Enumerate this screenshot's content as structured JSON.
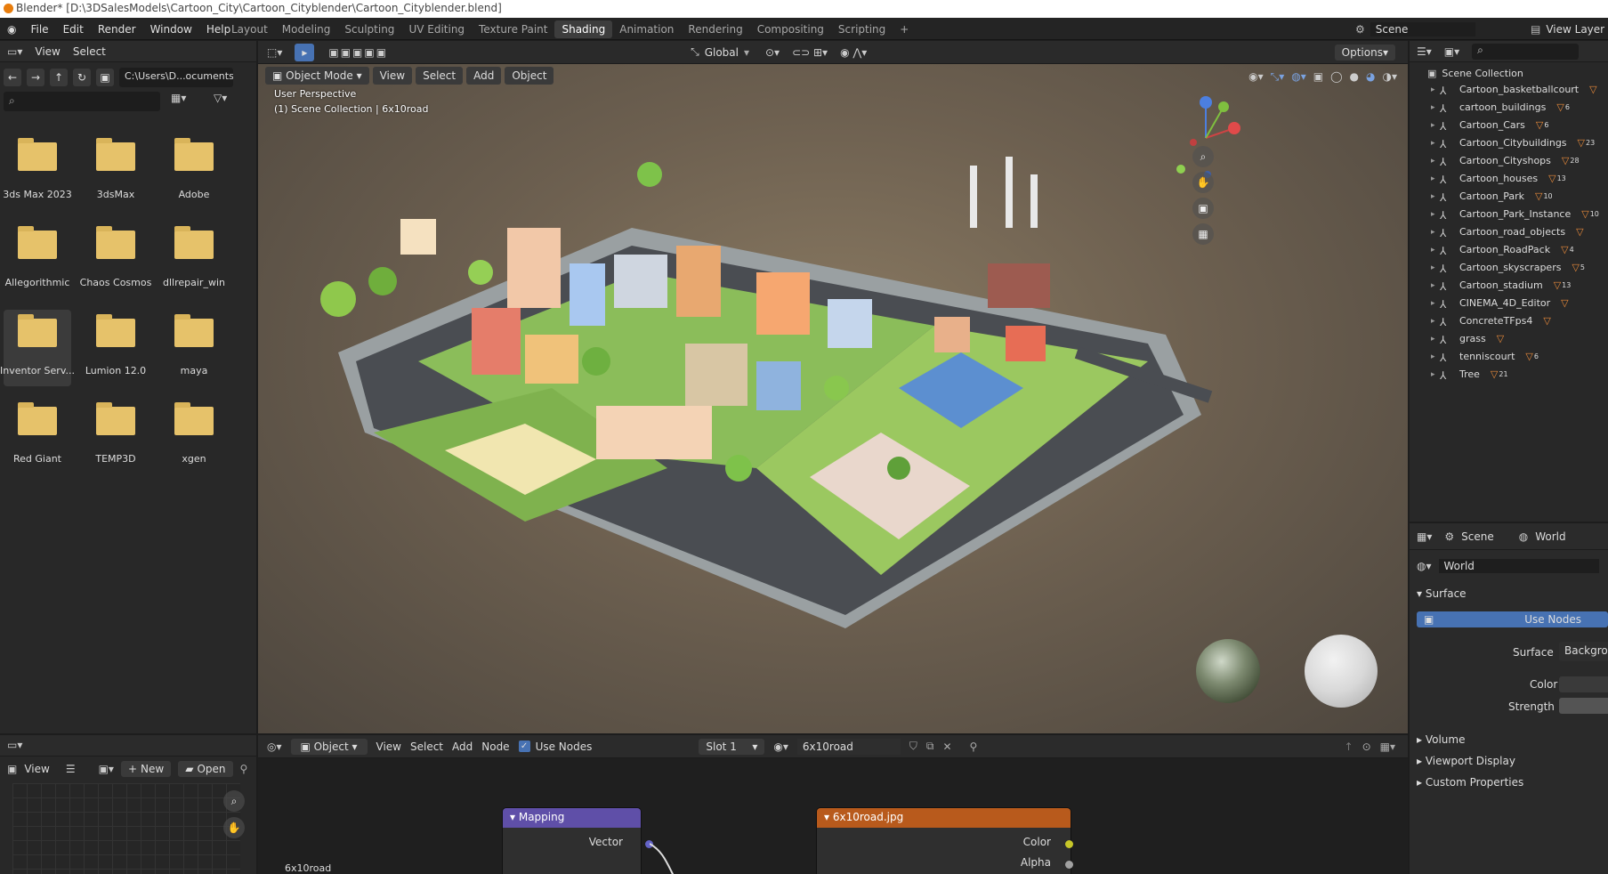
{
  "window": {
    "title": "Blender* [D:\\3DSalesModels\\Cartoon_City\\Cartoon_Cityblender\\Cartoon_Cityblender.blend]"
  },
  "menu": [
    "File",
    "Edit",
    "Render",
    "Window",
    "Help"
  ],
  "workspaces": [
    "Layout",
    "Modeling",
    "Sculpting",
    "UV Editing",
    "Texture Paint",
    "Shading",
    "Animation",
    "Rendering",
    "Compositing",
    "Scripting"
  ],
  "active_workspace": "Shading",
  "top_right": {
    "scene": "Scene",
    "view_layer": "View Layer"
  },
  "file_browser": {
    "menu_view": "View",
    "menu_select": "Select",
    "path": "C:\\Users\\D...ocuments\\",
    "search_placeholder": "",
    "folders": [
      "3ds Max 2023",
      "3dsMax",
      "Adobe",
      "Allegorithmic",
      "Chaos Cosmos",
      "dllrepair_win",
      "Inventor Serv...",
      "Lumion 12.0",
      "maya",
      "Red Giant",
      "TEMP3D",
      "xgen"
    ]
  },
  "viewport": {
    "mode": "Object Mode",
    "menus": [
      "View",
      "Select",
      "Add",
      "Object"
    ],
    "orientation": "Global",
    "options": "Options",
    "perspective": "User Perspective",
    "collection": "(1) Scene Collection | 6x10road"
  },
  "image_editor": {
    "view": "View",
    "new": "New",
    "open": "Open"
  },
  "node_editor": {
    "type": "Object",
    "menus": [
      "View",
      "Select",
      "Add",
      "Node"
    ],
    "use_nodes": "Use Nodes",
    "slot": "Slot 1",
    "material": "6x10road",
    "mapping_title": "Mapping",
    "mapping_vector": "Vector",
    "image_title": "6x10road.jpg",
    "image_color": "Color",
    "image_alpha": "Alpha",
    "frame_label": "6x10road"
  },
  "outliner": {
    "root": "Scene Collection",
    "items": [
      {
        "name": "Cartoon_basketballcourt",
        "badge": ""
      },
      {
        "name": "cartoon_buildings",
        "badge": "6"
      },
      {
        "name": "Cartoon_Cars",
        "badge": "6"
      },
      {
        "name": "Cartoon_Citybuildings",
        "badge": "23"
      },
      {
        "name": "Cartoon_Cityshops",
        "badge": "28"
      },
      {
        "name": "Cartoon_houses",
        "badge": "13"
      },
      {
        "name": "Cartoon_Park",
        "badge": "10"
      },
      {
        "name": "Cartoon_Park_Instance",
        "badge": "10"
      },
      {
        "name": "Cartoon_road_objects",
        "badge": ""
      },
      {
        "name": "Cartoon_RoadPack",
        "badge": "4"
      },
      {
        "name": "Cartoon_skyscrapers",
        "badge": "5"
      },
      {
        "name": "Cartoon_stadium",
        "badge": "13"
      },
      {
        "name": "CINEMA_4D_Editor",
        "badge": ""
      },
      {
        "name": "ConcreteTFps4",
        "badge": ""
      },
      {
        "name": "grass",
        "badge": ""
      },
      {
        "name": "tenniscourt",
        "badge": "6"
      },
      {
        "name": "Tree",
        "badge": "21"
      }
    ]
  },
  "properties": {
    "tab_scene": "Scene",
    "tab_world": "World",
    "world_name": "World",
    "surface_header": "Surface",
    "use_nodes": "Use Nodes",
    "surface_label": "Surface",
    "surface_value": "Background",
    "color_label": "Color",
    "strength_label": "Strength",
    "volume": "Volume",
    "viewport_display": "Viewport Display",
    "custom_properties": "Custom Properties"
  },
  "colors": {
    "accent": "#4772b3",
    "orange": "#e87d0d",
    "mapping_header": "#5f4fa8",
    "image_header": "#b85a1c"
  }
}
